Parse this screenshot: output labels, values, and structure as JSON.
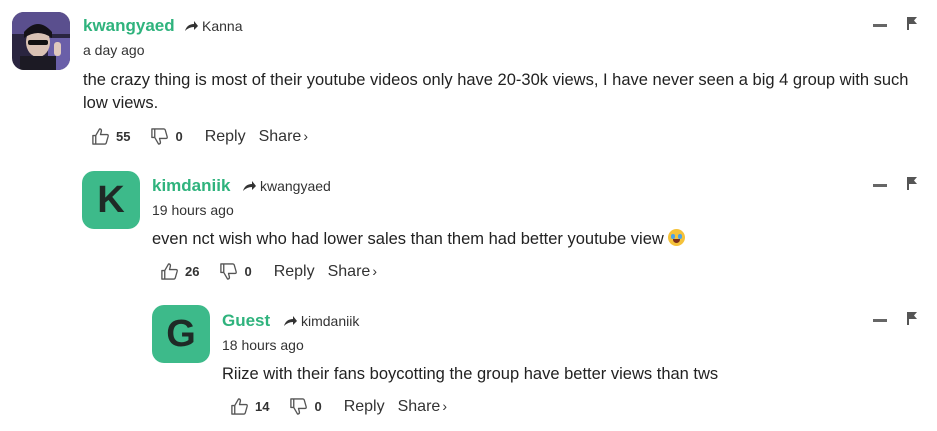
{
  "comments": [
    {
      "username": "kwangyaed",
      "reply_to": "Kanna",
      "time": "a day ago",
      "text": "the crazy thing is most of their youtube videos only have 20-30k views, I have never seen a big 4 group with such low views.",
      "upvotes": "55",
      "downvotes": "0",
      "reply_label": "Reply",
      "share_label": "Share",
      "share_chevron": "›"
    },
    {
      "avatar_letter": "K",
      "username": "kimdaniik",
      "reply_to": "kwangyaed",
      "time": "19 hours ago",
      "text": "even nct wish who had lower sales than them had better youtube view",
      "upvotes": "26",
      "downvotes": "0",
      "reply_label": "Reply",
      "share_label": "Share",
      "share_chevron": "›"
    },
    {
      "avatar_letter": "G",
      "username": "Guest",
      "reply_to": "kimdaniik",
      "time": "18 hours ago",
      "text": "Riize with their fans boycotting the group have better views than tws",
      "upvotes": "14",
      "downvotes": "0",
      "reply_label": "Reply",
      "share_label": "Share",
      "share_chevron": "›"
    }
  ],
  "colors": {
    "username": "#2fb37d",
    "avatar_bg": "#3dba8a",
    "text": "#222222"
  },
  "icons": [
    "reply-arrow-icon",
    "thumbs-up-icon",
    "thumbs-down-icon",
    "collapse-icon",
    "flag-icon",
    "crying-emoji-icon"
  ]
}
